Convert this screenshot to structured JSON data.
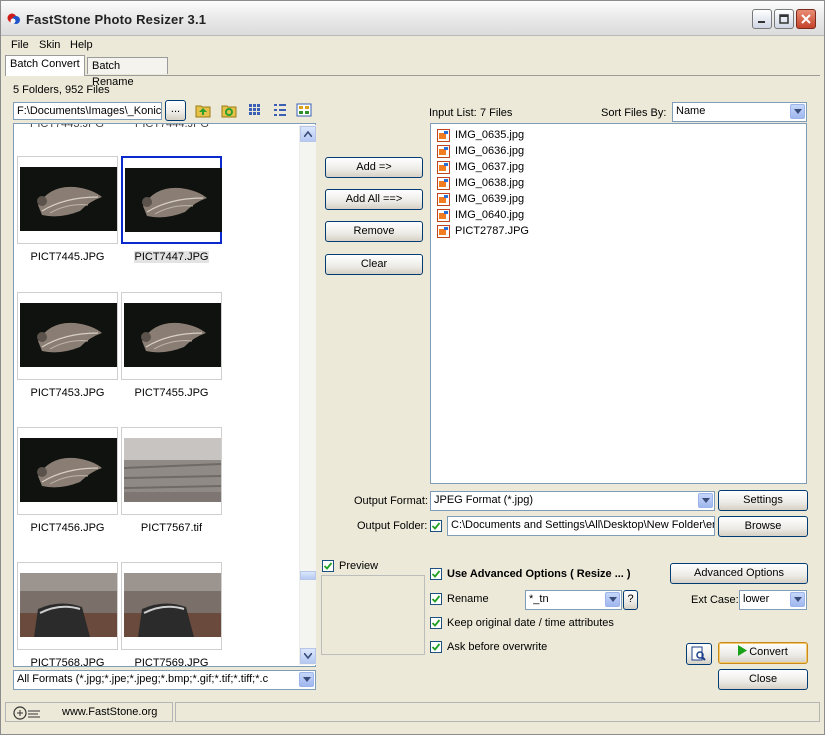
{
  "window": {
    "title": "FastStone Photo Resizer  3.1"
  },
  "menu": [
    "File",
    "Skin",
    "Help"
  ],
  "tabs": [
    "Batch Convert",
    "Batch Rename"
  ],
  "browser": {
    "folder_count": "5 Folders, 952 Files",
    "path": "F:\\Documents\\Images\\_Konica",
    "browse_label": "...",
    "thumbnails": [
      {
        "name": "PICT7445.JPG",
        "selected": false,
        "kind": "moth"
      },
      {
        "name": "PICT7447.JPG",
        "selected": true,
        "kind": "moth"
      },
      {
        "name": "PICT7453.JPG",
        "selected": false,
        "kind": "moth"
      },
      {
        "name": "PICT7455.JPG",
        "selected": false,
        "kind": "moth"
      },
      {
        "name": "PICT7456.JPG",
        "selected": false,
        "kind": "moth"
      },
      {
        "name": "PICT7567.tif",
        "selected": false,
        "kind": "wood"
      },
      {
        "name": "PICT7568.JPG",
        "selected": false,
        "kind": "bag"
      },
      {
        "name": "PICT7569.JPG",
        "selected": false,
        "kind": "bag"
      }
    ],
    "filter": "All Formats (*.jpg;*.jpe;*.jpeg;*.bmp;*.gif;*.tif;*.tiff;*.c"
  },
  "buttons": {
    "add": "Add =>",
    "add_all": "Add All ==>",
    "remove": "Remove",
    "clear": "Clear"
  },
  "input_list": {
    "label": "Input List:",
    "count": "7 Files",
    "sort_label": "Sort Files By:",
    "sort_value": "Name",
    "files": [
      "IMG_0635.jpg",
      "IMG_0636.jpg",
      "IMG_0637.jpg",
      "IMG_0638.jpg",
      "IMG_0639.jpg",
      "IMG_0640.jpg",
      "PICT2787.JPG"
    ]
  },
  "output": {
    "format_label": "Output Format:",
    "format_value": "JPEG Format (*.jpg)",
    "settings_label": "Settings",
    "folder_label": "Output Folder:",
    "folder_value": "C:\\Documents and Settings\\All\\Desktop\\New Folder\\em",
    "browse_label": "Browse"
  },
  "preview": {
    "label": "Preview",
    "checked": true
  },
  "options": {
    "advanced_label": "Use Advanced Options ( Resize ... )",
    "advanced_button": "Advanced Options",
    "rename_label": "Rename",
    "rename_value": "*_tn",
    "help_label": "?",
    "ext_case_label": "Ext Case:",
    "ext_case_value": "lower",
    "keep_date_label": "Keep original date / time attributes",
    "ask_overwrite_label": "Ask before overwrite"
  },
  "actions": {
    "convert": "Convert",
    "close": "Close"
  },
  "status": {
    "website": "www.FastStone.org"
  },
  "colors": {
    "selection_border": "#0a2acd",
    "convert_arrow": "#1aa31a",
    "field_border": "#7f9db9"
  }
}
